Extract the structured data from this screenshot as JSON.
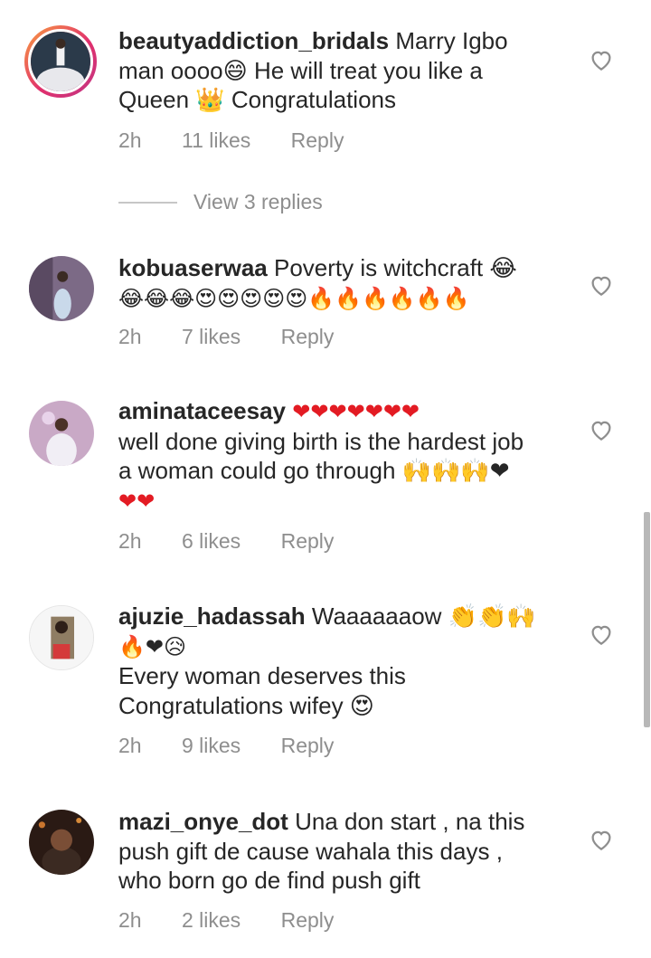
{
  "comments": [
    {
      "username": "beautyaddiction_bridals",
      "lines": [
        "Marry Igbo",
        "man oooo😄 He will treat you like a",
        "Queen 👑 Congratulations"
      ],
      "time": "2h",
      "likes": "11 likes",
      "reply": "Reply"
    },
    {
      "username": "kobuaserwaa",
      "lines": [
        "Poverty is witchcraft 😂",
        "😂😂😂😍😍😍😍😍🔥🔥🔥🔥🔥🔥"
      ],
      "time": "2h",
      "likes": "7 likes",
      "reply": "Reply"
    },
    {
      "username": "aminataceesay",
      "lines": [
        "❤❤❤❤❤❤❤",
        "well done giving birth is the hardest job",
        "a woman could go through 🙌🙌🙌❤",
        "❤❤"
      ],
      "time": "2h",
      "likes": "6 likes",
      "reply": "Reply"
    },
    {
      "username": "ajuzie_hadassah",
      "lines": [
        "Waaaaaaow 👏👏🙌",
        "🔥❤😥",
        "Every woman deserves this",
        "Congratulations wifey 😍"
      ],
      "time": "2h",
      "likes": "9 likes",
      "reply": "Reply"
    },
    {
      "username": "mazi_onye_dot",
      "lines": [
        "Una don start , na this",
        "push gift de cause wahala this days ,",
        "who born go de find push gift"
      ],
      "time": "2h",
      "likes": "2 likes",
      "reply": "Reply"
    }
  ],
  "view_replies": "View 3 replies",
  "icons": {
    "like": "heart-outline-icon"
  },
  "colors": {
    "text": "#262626",
    "meta": "#8e8e8e",
    "heart": "#e31b23"
  }
}
